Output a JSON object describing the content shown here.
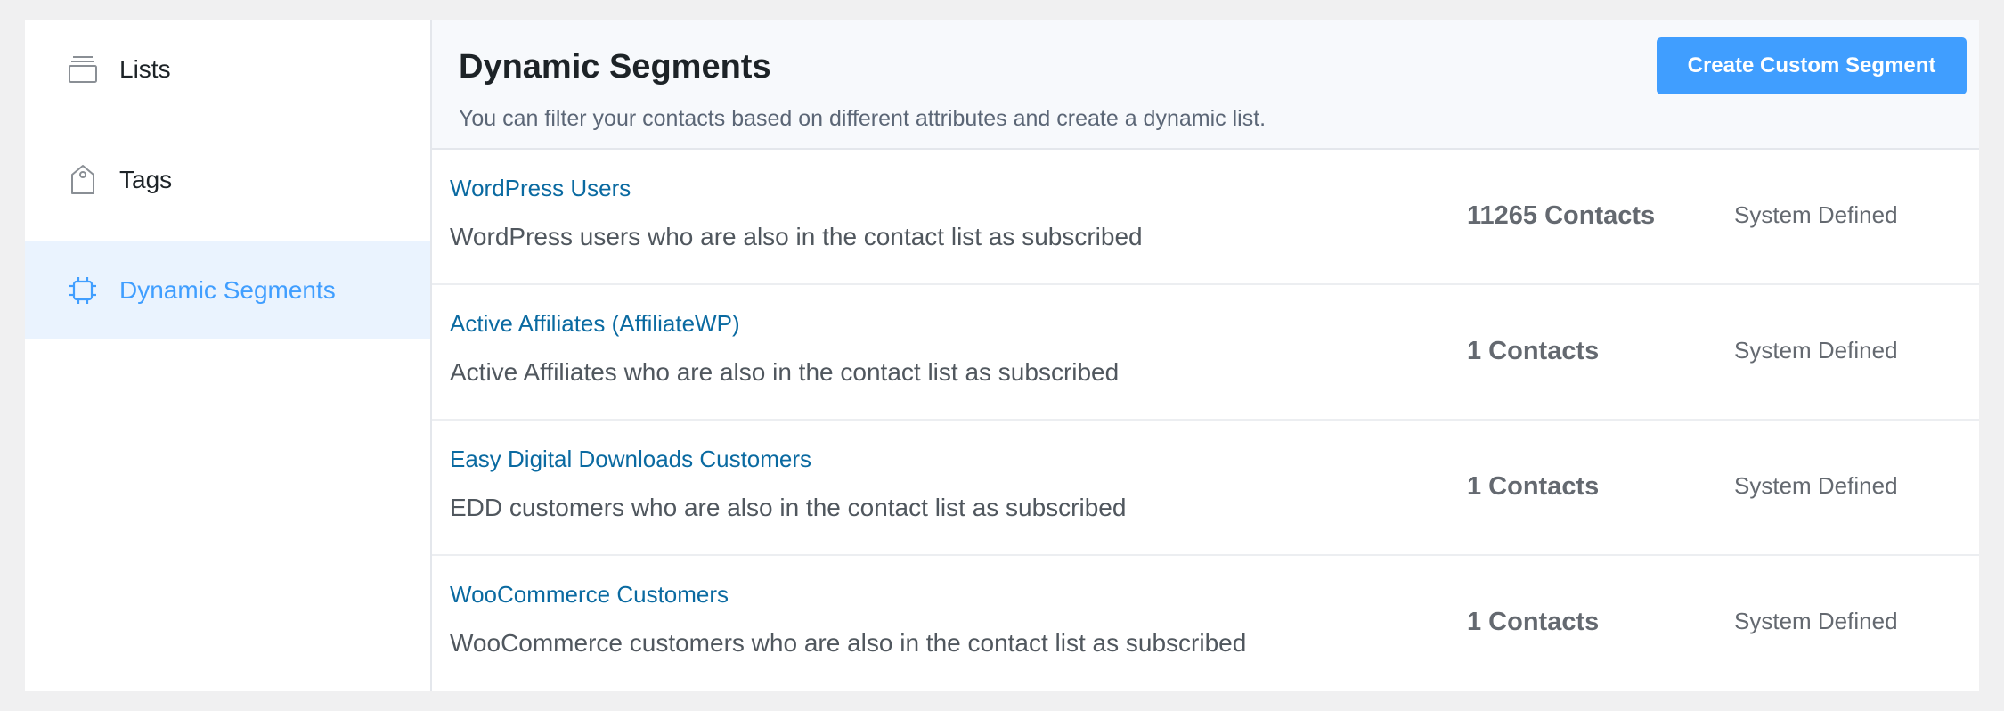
{
  "sidebar": {
    "items": [
      {
        "label": "Lists",
        "icon": "list-stack-icon"
      },
      {
        "label": "Tags",
        "icon": "tag-icon"
      },
      {
        "label": "Dynamic Segments",
        "icon": "chip-icon"
      }
    ],
    "active_index": 2
  },
  "header": {
    "title": "Dynamic Segments",
    "subtitle": "You can filter your contacts based on different attributes and create a dynamic list.",
    "create_button_label": "Create Custom Segment"
  },
  "segments": [
    {
      "title": "WordPress Users",
      "description": "WordPress users who are also in the contact list as subscribed",
      "count": "11265 Contacts",
      "type": "System Defined"
    },
    {
      "title": "Active Affiliates (AffiliateWP)",
      "description": "Active Affiliates who are also in the contact list as subscribed",
      "count": "1 Contacts",
      "type": "System Defined"
    },
    {
      "title": "Easy Digital Downloads Customers",
      "description": "EDD customers who are also in the contact list as subscribed",
      "count": "1 Contacts",
      "type": "System Defined"
    },
    {
      "title": "WooCommerce Customers",
      "description": "WooCommerce customers who are also in the contact list as subscribed",
      "count": "1 Contacts",
      "type": "System Defined"
    }
  ],
  "colors": {
    "accent": "#409eff",
    "link": "#0a6aa1",
    "active_bg": "#eaf3fe"
  }
}
